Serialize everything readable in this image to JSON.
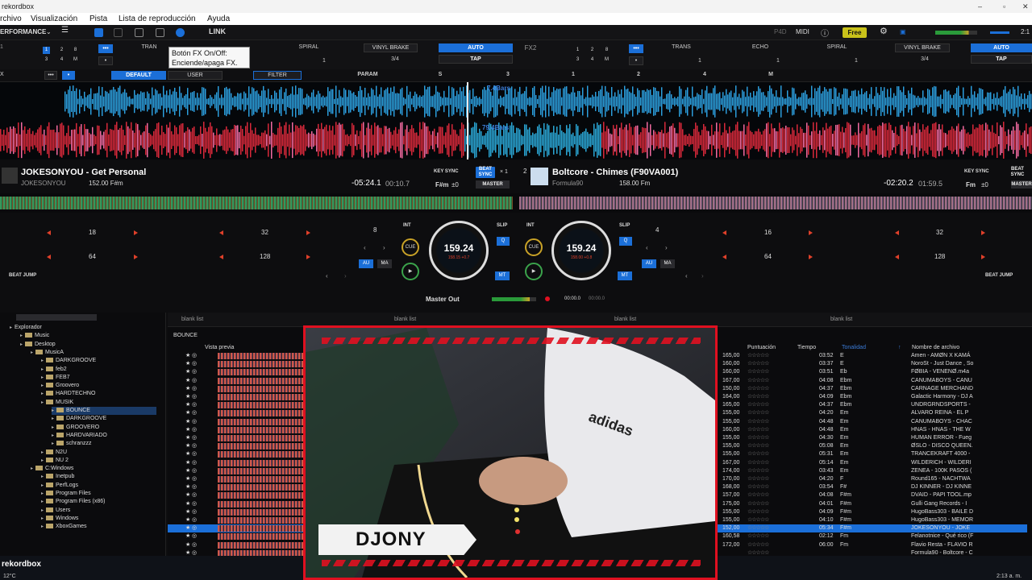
{
  "window": {
    "title": "rekordbox"
  },
  "menu": [
    "rchivo",
    "Visualización",
    "Pista",
    "Lista de reproducción",
    "Ayuda"
  ],
  "toolbar": {
    "mode": "ERFORMANCE",
    "link": "LINK",
    "free": "Free",
    "p4d": "P4D",
    "midi": "MIDI",
    "clock": "2:1"
  },
  "tooltip": {
    "line1": "Botón FX On/Off:",
    "line2": "Enciende/apaga FX."
  },
  "fx1": {
    "effects": [
      "TRAN",
      "",
      "SPIRAL",
      "VINYL BRAKE"
    ],
    "auto": "AUTO",
    "tap": "TAP",
    "beat": "3/4",
    "numbers": [
      "1",
      "2",
      "3",
      "4",
      "M"
    ],
    "counts": [
      "1",
      "1"
    ]
  },
  "fx2": {
    "label": "FX2",
    "effects": [
      "TRANS",
      "ECHO",
      "SPIRAL",
      "VINYL BRAKE"
    ],
    "auto": "AUTO",
    "tap": "TAP",
    "beat": "3/4",
    "counts": [
      "1",
      "1",
      "1"
    ]
  },
  "fxrow2": {
    "label": "X",
    "default": "DEFAULT",
    "user": "USER",
    "filter": "FILTER",
    "param": "PARAM",
    "marks": [
      "S",
      "3",
      "1",
      "2",
      "4",
      "M"
    ]
  },
  "waves": {
    "top_label": "7.4Bars",
    "bottom_label": "79.4Bars"
  },
  "deck1": {
    "title": "JOKESONYOU - Get Personal",
    "artist": "JOKESONYOU",
    "bpm_key": "152.00  F#m",
    "remain": "-05:24.1",
    "elapsed": "00:10.7",
    "key": "F#m",
    "keyshift": "±0",
    "keysync": "KEY SYNC",
    "beatsync": "BEAT SYNC",
    "master": "MASTER",
    "x1": "× 1"
  },
  "deck2": {
    "num": "2",
    "title": "Boltcore - Chimes (F90VA001)",
    "artist": "Formula90",
    "bpm_key": "158.00  Fm",
    "remain": "-02:20.2",
    "elapsed": "01:59.5",
    "key": "Fm",
    "keyshift": "±0",
    "keysync": "KEY SYNC",
    "beatsync": "BEAT SYNC",
    "master": "MASTER"
  },
  "pads1": {
    "a": "18",
    "b": "32",
    "c": "64",
    "d": "128",
    "loop": "8",
    "beatjump": "BEAT JUMP"
  },
  "pads2": {
    "a": "16",
    "b": "32",
    "c": "64",
    "d": "128",
    "loop": "4",
    "beatjump": "BEAT JUMP"
  },
  "jog1": {
    "bpm": "159.24",
    "sub": "158.15  +0.7"
  },
  "jog2": {
    "bpm": "159.24",
    "sub": "158.00  +0.8"
  },
  "controls": {
    "int": "INT",
    "slip": "SLIP",
    "cue": "CUE",
    "q": "Q",
    "au": "AU",
    "ma": "MA",
    "mt": "MT"
  },
  "mixer": {
    "master_out": "Master Out",
    "time_a": "00:00.0",
    "time_b": "00:00.0"
  },
  "tree": [
    {
      "label": "Explorador",
      "level": 0
    },
    {
      "label": "Music",
      "level": 1
    },
    {
      "label": "Desktop",
      "level": 1
    },
    {
      "label": "MusicA",
      "level": 2
    },
    {
      "label": "DARKGROOVE",
      "level": 3
    },
    {
      "label": "feb2",
      "level": 3
    },
    {
      "label": "FEB7",
      "level": 3
    },
    {
      "label": "Groovero",
      "level": 3
    },
    {
      "label": "HARDTECHNO",
      "level": 3
    },
    {
      "label": "MUSIK",
      "level": 3
    },
    {
      "label": "BOUNCE",
      "level": 4,
      "selected": true
    },
    {
      "label": "DARKGROOVE",
      "level": 4
    },
    {
      "label": "GROOVERO",
      "level": 4
    },
    {
      "label": "HARDVARIADO",
      "level": 4
    },
    {
      "label": "schranzzz",
      "level": 4
    },
    {
      "label": "N2U",
      "level": 3
    },
    {
      "label": "NU 2",
      "level": 3
    },
    {
      "label": "C:Windows",
      "level": 2
    },
    {
      "label": "Inetpub",
      "level": 3
    },
    {
      "label": "PerfLogs",
      "level": 3
    },
    {
      "label": "Program Files",
      "level": 3
    },
    {
      "label": "Program Files (x86)",
      "level": 3
    },
    {
      "label": "Users",
      "level": 3
    },
    {
      "label": "Windows",
      "level": 3
    },
    {
      "label": "XboxGames",
      "level": 3
    }
  ],
  "browser": {
    "blank": "blank list",
    "folder": "BOUNCE",
    "preview": "Vista previa",
    "col_rating": "Puntuación",
    "col_time": "Tiempo",
    "col_key": "Tonalidad",
    "col_file": "Nombre de archivo"
  },
  "tracks": [
    [
      "165,00",
      "03:52",
      "E",
      "Amen - AMØN X KAMÁ"
    ],
    [
      "160,00",
      "03:37",
      "E",
      "NoroSt - Just Dance , So"
    ],
    [
      "160,00",
      "03:51",
      "Eb",
      "FØBIA - VENENØ.m4a"
    ],
    [
      "167,00",
      "04:08",
      "Ebm",
      "CANUMABOYS - CANU"
    ],
    [
      "150,00",
      "04:37",
      "Ebm",
      "CARNAGE MERCHAND"
    ],
    [
      "164,00",
      "04:09",
      "Ebm",
      "Galactic Harmony - DJ A"
    ],
    [
      "165,00",
      "04:37",
      "Ebm",
      "UNDRGRNDSPORTS -"
    ],
    [
      "155,00",
      "04:20",
      "Em",
      "ALVARO REINA - EL P"
    ],
    [
      "155,00",
      "04:48",
      "Em",
      "CANUMABOYS - CHAC"
    ],
    [
      "160,00",
      "04:48",
      "Em",
      "HNAS - HNAS - THE W"
    ],
    [
      "155,00",
      "04:30",
      "Em",
      "HUMAN ERROR - Fueg"
    ],
    [
      "155,00",
      "05:08",
      "Em",
      "ØSLO - DISCO QUEEN."
    ],
    [
      "155,00",
      "05:31",
      "Em",
      "TRANCEKRAFT 4000 -"
    ],
    [
      "167,00",
      "05:14",
      "Em",
      "WILDERICH - WILDERI"
    ],
    [
      "174,00",
      "03:43",
      "Em",
      "ZENEA - 100K PASOS ("
    ],
    [
      "170,00",
      "04:20",
      "F",
      "Round165 - NACHTWA"
    ],
    [
      "168,00",
      "03:54",
      "F#",
      "DJ KINNER - DJ KINNE"
    ],
    [
      "157,00",
      "04:08",
      "F#m",
      "DVAID - PAPI TOOL.mp"
    ],
    [
      "175,00",
      "04:01",
      "F#m",
      "Gulli Gang Records - I"
    ],
    [
      "155,00",
      "04:09",
      "F#m",
      "HugoBass303 - BAILE D"
    ],
    [
      "155,00",
      "04:10",
      "F#m",
      "HugoBass303 - MEMOR"
    ],
    [
      "152,00",
      "05:34",
      "F#m",
      "JOKESONYOU - JOKE"
    ],
    [
      "160,58",
      "02:12",
      "Fm",
      "Felanotnice - Qué rico (F"
    ],
    [
      "172,00",
      "06:00",
      "Fm",
      "Flavio Resta - FLAVIO R"
    ],
    [
      "",
      "",
      "",
      "Formula90 - Boltcore - C"
    ]
  ],
  "selected_track": 21,
  "cam": {
    "name": "DJONY"
  },
  "taskbar": {
    "app": "rekordbox",
    "temp": "12°C",
    "time": "2:13 a. m."
  },
  "colors": {
    "accent": "#1b6fd8",
    "cam_border": "#e01020"
  }
}
